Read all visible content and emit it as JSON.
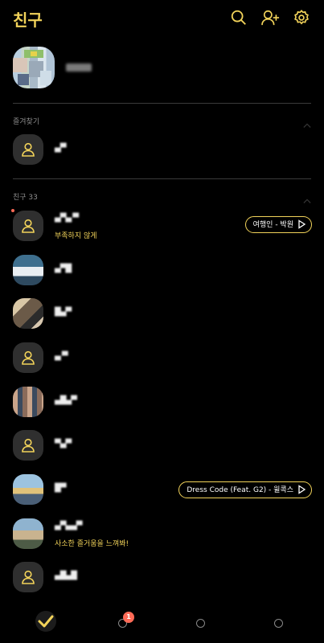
{
  "header": {
    "title": "친구"
  },
  "sections": {
    "favorites_label": "즐겨찾기",
    "friends_label": "친구 33"
  },
  "friends": [
    {
      "name": "▄▀▄ ▀",
      "status": "부족하지 않게",
      "music": "여행인 - 박원"
    },
    {
      "name": "▄▀█"
    },
    {
      "name": "█▄▀"
    },
    {
      "name": "▄ ▀"
    },
    {
      "name": "▄█▄▀"
    },
    {
      "name": "▀▄▀"
    },
    {
      "name": "█▀",
      "music": "Dress Code (Feat. G2) - 윌콕스"
    },
    {
      "name": "▄▀▄▄▀",
      "status": "사소한 즐거움을 느껴봐!"
    },
    {
      "name": "▄█▄█"
    }
  ],
  "favorite": {
    "name": "▄▀"
  },
  "tabs": {
    "badge_count": "1"
  },
  "colors": {
    "accent": "#f2d35a",
    "badge": "#ff6b57",
    "background": "#000000"
  }
}
